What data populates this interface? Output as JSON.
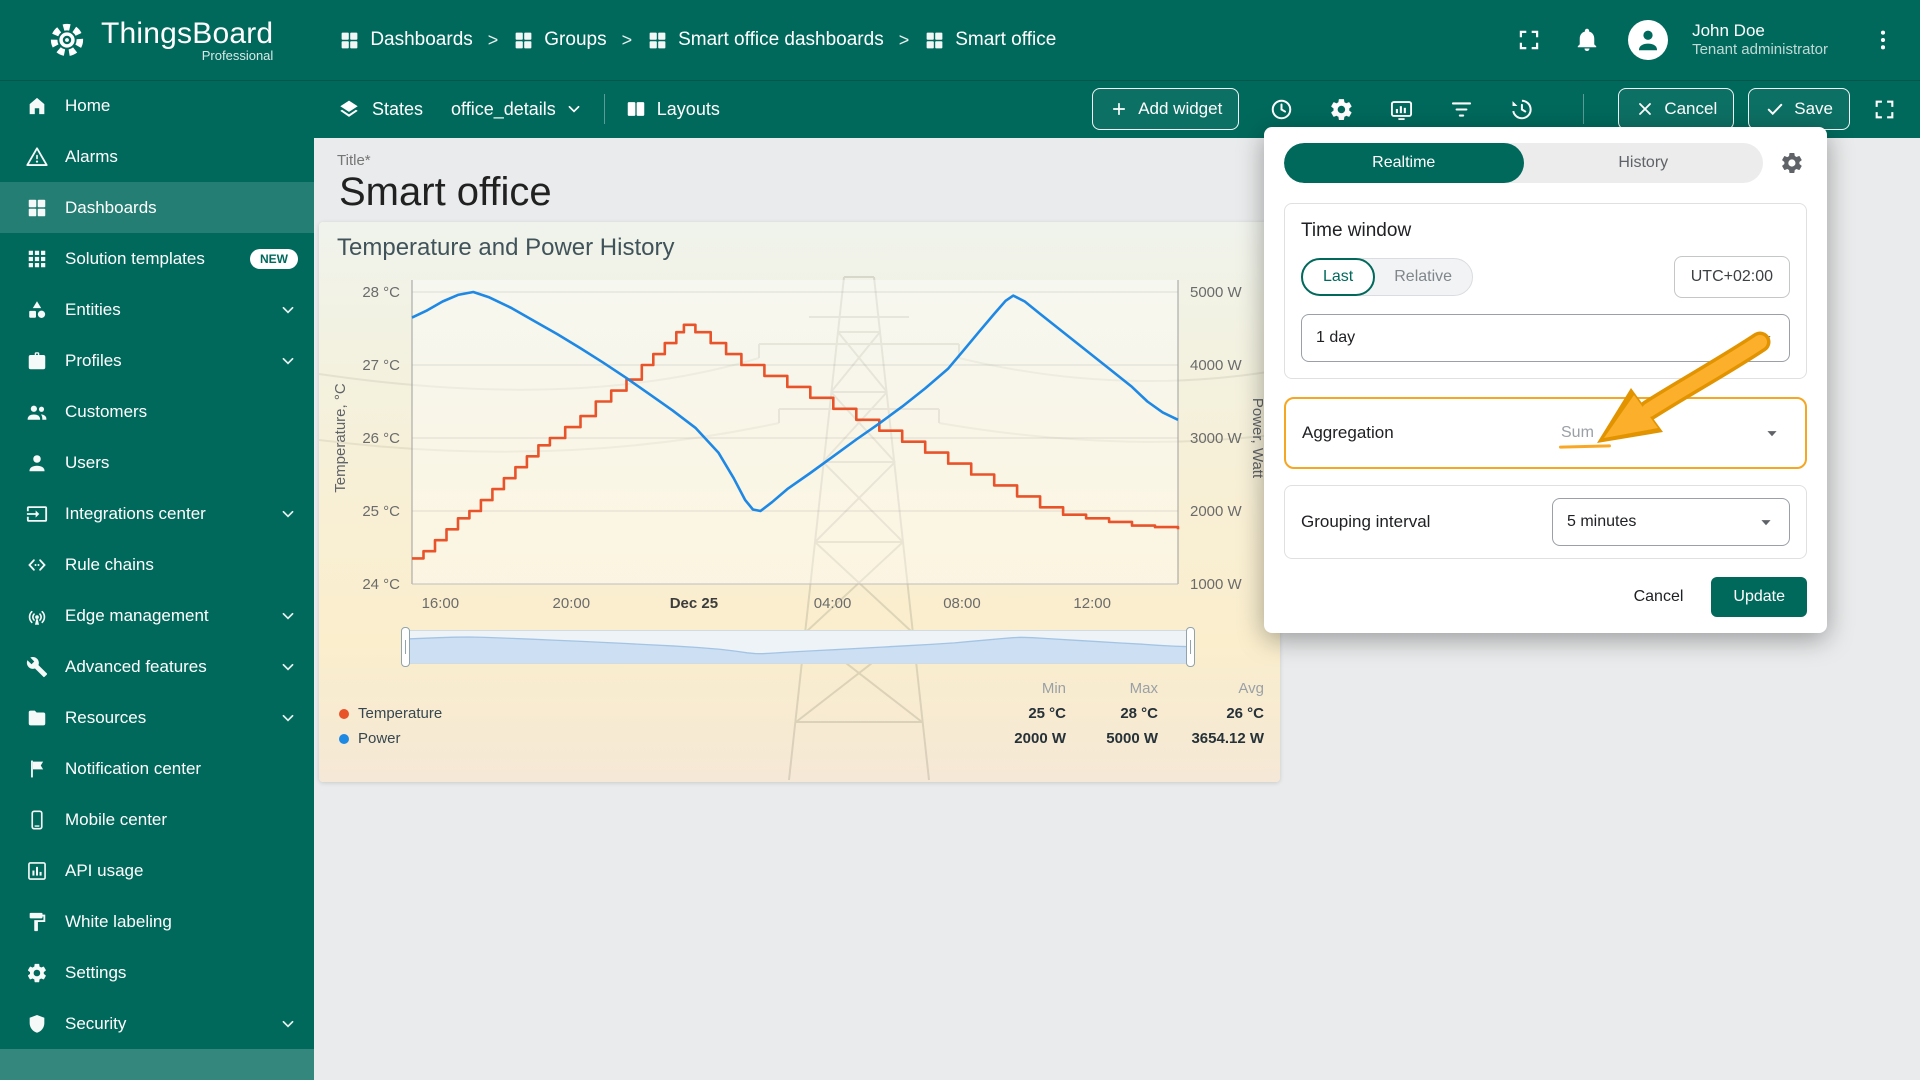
{
  "app": {
    "name": "ThingsBoard",
    "edition": "Professional"
  },
  "header": {
    "breadcrumbs": [
      "Dashboards",
      "Groups",
      "Smart office dashboards",
      "Smart office"
    ],
    "icons": [
      "fullscreen-icon",
      "notifications-icon",
      "avatar",
      "menu-kebab-icon"
    ],
    "user": {
      "name": "John Doe",
      "role": "Tenant administrator"
    }
  },
  "sidebar": {
    "items": [
      {
        "id": "home",
        "label": "Home",
        "icon": "home"
      },
      {
        "id": "alarms",
        "label": "Alarms",
        "icon": "alarms"
      },
      {
        "id": "dashboards",
        "label": "Dashboards",
        "icon": "dashboards",
        "active": true
      },
      {
        "id": "solution-templates",
        "label": "Solution templates",
        "icon": "solution-templates",
        "badge": "NEW"
      },
      {
        "id": "entities",
        "label": "Entities",
        "icon": "entities",
        "expandable": true
      },
      {
        "id": "profiles",
        "label": "Profiles",
        "icon": "profiles",
        "expandable": true
      },
      {
        "id": "customers",
        "label": "Customers",
        "icon": "customers"
      },
      {
        "id": "users",
        "label": "Users",
        "icon": "users"
      },
      {
        "id": "integrations-center",
        "label": "Integrations center",
        "icon": "integrations-center",
        "expandable": true
      },
      {
        "id": "rule-chains",
        "label": "Rule chains",
        "icon": "rule-chains"
      },
      {
        "id": "edge-management",
        "label": "Edge management",
        "icon": "edge-management",
        "expandable": true
      },
      {
        "id": "advanced-features",
        "label": "Advanced features",
        "icon": "advanced-features",
        "expandable": true
      },
      {
        "id": "resources",
        "label": "Resources",
        "icon": "resources",
        "expandable": true
      },
      {
        "id": "notification-center",
        "label": "Notification center",
        "icon": "notification-center"
      },
      {
        "id": "mobile-center",
        "label": "Mobile center",
        "icon": "mobile-center"
      },
      {
        "id": "api-usage",
        "label": "API usage",
        "icon": "api-usage"
      },
      {
        "id": "white-labeling",
        "label": "White labeling",
        "icon": "white-labeling"
      },
      {
        "id": "settings",
        "label": "Settings",
        "icon": "settings"
      },
      {
        "id": "security",
        "label": "Security",
        "icon": "security",
        "expandable": true
      }
    ]
  },
  "toolbar": {
    "states_label": "States",
    "state_value": "office_details",
    "layouts_label": "Layouts",
    "add_widget_label": "Add widget",
    "icon_buttons": [
      "time-window-icon",
      "dashboard-settings-icon",
      "entity-aliases-icon",
      "filters-icon",
      "version-control-icon"
    ],
    "cancel_label": "Cancel",
    "save_label": "Save"
  },
  "dashboard": {
    "title_label": "Title*",
    "title": "Smart office"
  },
  "chart_data": {
    "type": "line",
    "title": "Temperature and Power History",
    "y_left": {
      "label": "Temperature, °C",
      "min": 24,
      "max": 28,
      "tick_step": 1,
      "unit": "°C"
    },
    "y_right": {
      "label": "Power, Watt",
      "min": 1000,
      "max": 5000,
      "tick_step": 1000,
      "unit": "W"
    },
    "x_ticks": [
      {
        "pos": 0.037,
        "label": "16:00"
      },
      {
        "pos": 0.208,
        "label": "20:00"
      },
      {
        "pos": 0.368,
        "label": "Dec 25",
        "bold": true
      },
      {
        "pos": 0.549,
        "label": "04:00"
      },
      {
        "pos": 0.718,
        "label": "08:00"
      },
      {
        "pos": 0.888,
        "label": "12:00"
      }
    ],
    "grid": "horizontal",
    "legend_position": "bottom",
    "series": [
      {
        "name": "Temperature",
        "color": "#e8532a",
        "axis": "left",
        "style": "step",
        "stats": {
          "min": "25 °C",
          "max": "28 °C",
          "avg": "26 °C"
        },
        "points": [
          [
            0.0,
            24.35
          ],
          [
            0.015,
            24.45
          ],
          [
            0.03,
            24.6
          ],
          [
            0.045,
            24.75
          ],
          [
            0.06,
            24.9
          ],
          [
            0.075,
            25.0
          ],
          [
            0.09,
            25.15
          ],
          [
            0.105,
            25.3
          ],
          [
            0.12,
            25.45
          ],
          [
            0.135,
            25.6
          ],
          [
            0.15,
            25.75
          ],
          [
            0.165,
            25.9
          ],
          [
            0.18,
            26.0
          ],
          [
            0.2,
            26.15
          ],
          [
            0.22,
            26.3
          ],
          [
            0.24,
            26.5
          ],
          [
            0.26,
            26.65
          ],
          [
            0.28,
            26.8
          ],
          [
            0.3,
            27.0
          ],
          [
            0.315,
            27.15
          ],
          [
            0.33,
            27.3
          ],
          [
            0.345,
            27.45
          ],
          [
            0.355,
            27.55
          ],
          [
            0.37,
            27.45
          ],
          [
            0.39,
            27.3
          ],
          [
            0.41,
            27.15
          ],
          [
            0.43,
            27.0
          ],
          [
            0.46,
            26.85
          ],
          [
            0.49,
            26.7
          ],
          [
            0.52,
            26.55
          ],
          [
            0.55,
            26.4
          ],
          [
            0.58,
            26.25
          ],
          [
            0.61,
            26.1
          ],
          [
            0.64,
            25.95
          ],
          [
            0.67,
            25.8
          ],
          [
            0.7,
            25.65
          ],
          [
            0.73,
            25.5
          ],
          [
            0.76,
            25.35
          ],
          [
            0.79,
            25.2
          ],
          [
            0.82,
            25.05
          ],
          [
            0.85,
            24.95
          ],
          [
            0.88,
            24.9
          ],
          [
            0.91,
            24.85
          ],
          [
            0.94,
            24.8
          ],
          [
            0.97,
            24.78
          ],
          [
            1.0,
            24.75
          ]
        ]
      },
      {
        "name": "Power",
        "color": "#1e88e5",
        "axis": "right",
        "style": "line",
        "stats": {
          "min": "2000 W",
          "max": "5000 W",
          "avg": "3654.12 W"
        },
        "points": [
          [
            0.0,
            4650
          ],
          [
            0.02,
            4750
          ],
          [
            0.04,
            4870
          ],
          [
            0.06,
            4960
          ],
          [
            0.08,
            5000
          ],
          [
            0.1,
            4930
          ],
          [
            0.13,
            4780
          ],
          [
            0.16,
            4600
          ],
          [
            0.19,
            4420
          ],
          [
            0.22,
            4230
          ],
          [
            0.25,
            4030
          ],
          [
            0.28,
            3820
          ],
          [
            0.31,
            3600
          ],
          [
            0.34,
            3380
          ],
          [
            0.37,
            3140
          ],
          [
            0.4,
            2800
          ],
          [
            0.42,
            2450
          ],
          [
            0.435,
            2150
          ],
          [
            0.445,
            2020
          ],
          [
            0.455,
            2000
          ],
          [
            0.47,
            2120
          ],
          [
            0.49,
            2300
          ],
          [
            0.52,
            2520
          ],
          [
            0.55,
            2750
          ],
          [
            0.58,
            2980
          ],
          [
            0.61,
            3200
          ],
          [
            0.64,
            3430
          ],
          [
            0.67,
            3680
          ],
          [
            0.7,
            3950
          ],
          [
            0.72,
            4200
          ],
          [
            0.74,
            4450
          ],
          [
            0.76,
            4700
          ],
          [
            0.775,
            4880
          ],
          [
            0.785,
            4950
          ],
          [
            0.8,
            4870
          ],
          [
            0.82,
            4700
          ],
          [
            0.85,
            4450
          ],
          [
            0.88,
            4200
          ],
          [
            0.91,
            3950
          ],
          [
            0.94,
            3700
          ],
          [
            0.96,
            3500
          ],
          [
            0.98,
            3350
          ],
          [
            1.0,
            3250
          ]
        ]
      }
    ]
  },
  "legend": {
    "headers": [
      "Min",
      "Max",
      "Avg"
    ]
  },
  "popup": {
    "tabs": [
      {
        "label": "Realtime",
        "active": true
      },
      {
        "label": "History",
        "active": false
      }
    ],
    "time_window": {
      "heading": "Time window",
      "options": [
        "Last",
        "Relative"
      ],
      "selected": "Last",
      "timezone": "UTC+02:00",
      "interval": "1 day"
    },
    "aggregation": {
      "label": "Aggregation",
      "value": "Sum"
    },
    "grouping": {
      "label": "Grouping interval",
      "value": "5 minutes"
    },
    "cancel_label": "Cancel",
    "update_label": "Update"
  },
  "colors": {
    "primary": "#00695c",
    "highlight": "#f9a825",
    "temperature": "#e8532a",
    "power": "#1e88e5"
  }
}
